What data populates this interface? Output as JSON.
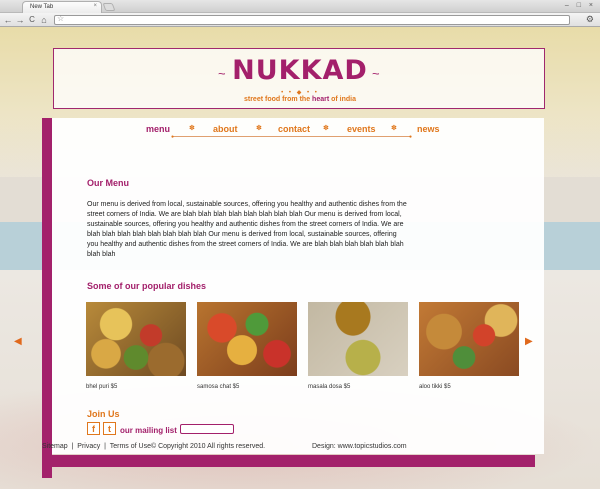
{
  "browser": {
    "tab_title": "New Tab",
    "tab_close": "×",
    "window_controls": "– □ ×",
    "back_icon": "←",
    "forward_icon": "→",
    "reload_icon": "C",
    "home_icon": "⌂",
    "star_icon": "☆",
    "wrench_icon": "⚙"
  },
  "header": {
    "logo": "NUKKAD",
    "tagline_pre": "street food from the ",
    "tagline_bold": "heart",
    "tagline_post": " of india"
  },
  "nav": {
    "items": [
      {
        "label": "menu",
        "active": true
      },
      {
        "label": "about",
        "active": false
      },
      {
        "label": "contact",
        "active": false
      },
      {
        "label": "events",
        "active": false
      },
      {
        "label": "news",
        "active": false
      }
    ],
    "separator": "✽"
  },
  "menu_section": {
    "title": "Our Menu",
    "body": "Our menu is derived from local, sustainable sources, offering you healthy and authentic dishes from the street corners of India. We are blah blah blah blah blah blah blah blah Our menu is derived from local, sustainable sources, offering you healthy and authentic dishes from the street corners of India. We are blah blah blah blah blah blah blah blah Our menu is derived from local, sustainable sources, offering you healthy and authentic dishes from the street corners of India. We are blah blah blah blah blah blah blah blah"
  },
  "dishes_section": {
    "title": "Some of our popular dishes",
    "prev_arrow": "◀",
    "next_arrow": "▶",
    "dishes": [
      {
        "name": "bhel puri $5"
      },
      {
        "name": "samosa chat $5"
      },
      {
        "name": "masala dosa $5"
      },
      {
        "name": "aloo tikki $5"
      }
    ]
  },
  "join": {
    "title": "Join Us",
    "facebook": "f",
    "twitter": "t",
    "mailing_label": "our mailing list"
  },
  "footer": {
    "sitemap": "Sitemap",
    "sep": "|",
    "privacy": "Privacy",
    "terms": "Terms of Use",
    "copyright": "© Copyright 2010  All rights reserved.",
    "design": "Design: www.topicstudios.com"
  },
  "colors": {
    "brand_magenta": "#a3206b",
    "brand_orange": "#e0771c"
  }
}
